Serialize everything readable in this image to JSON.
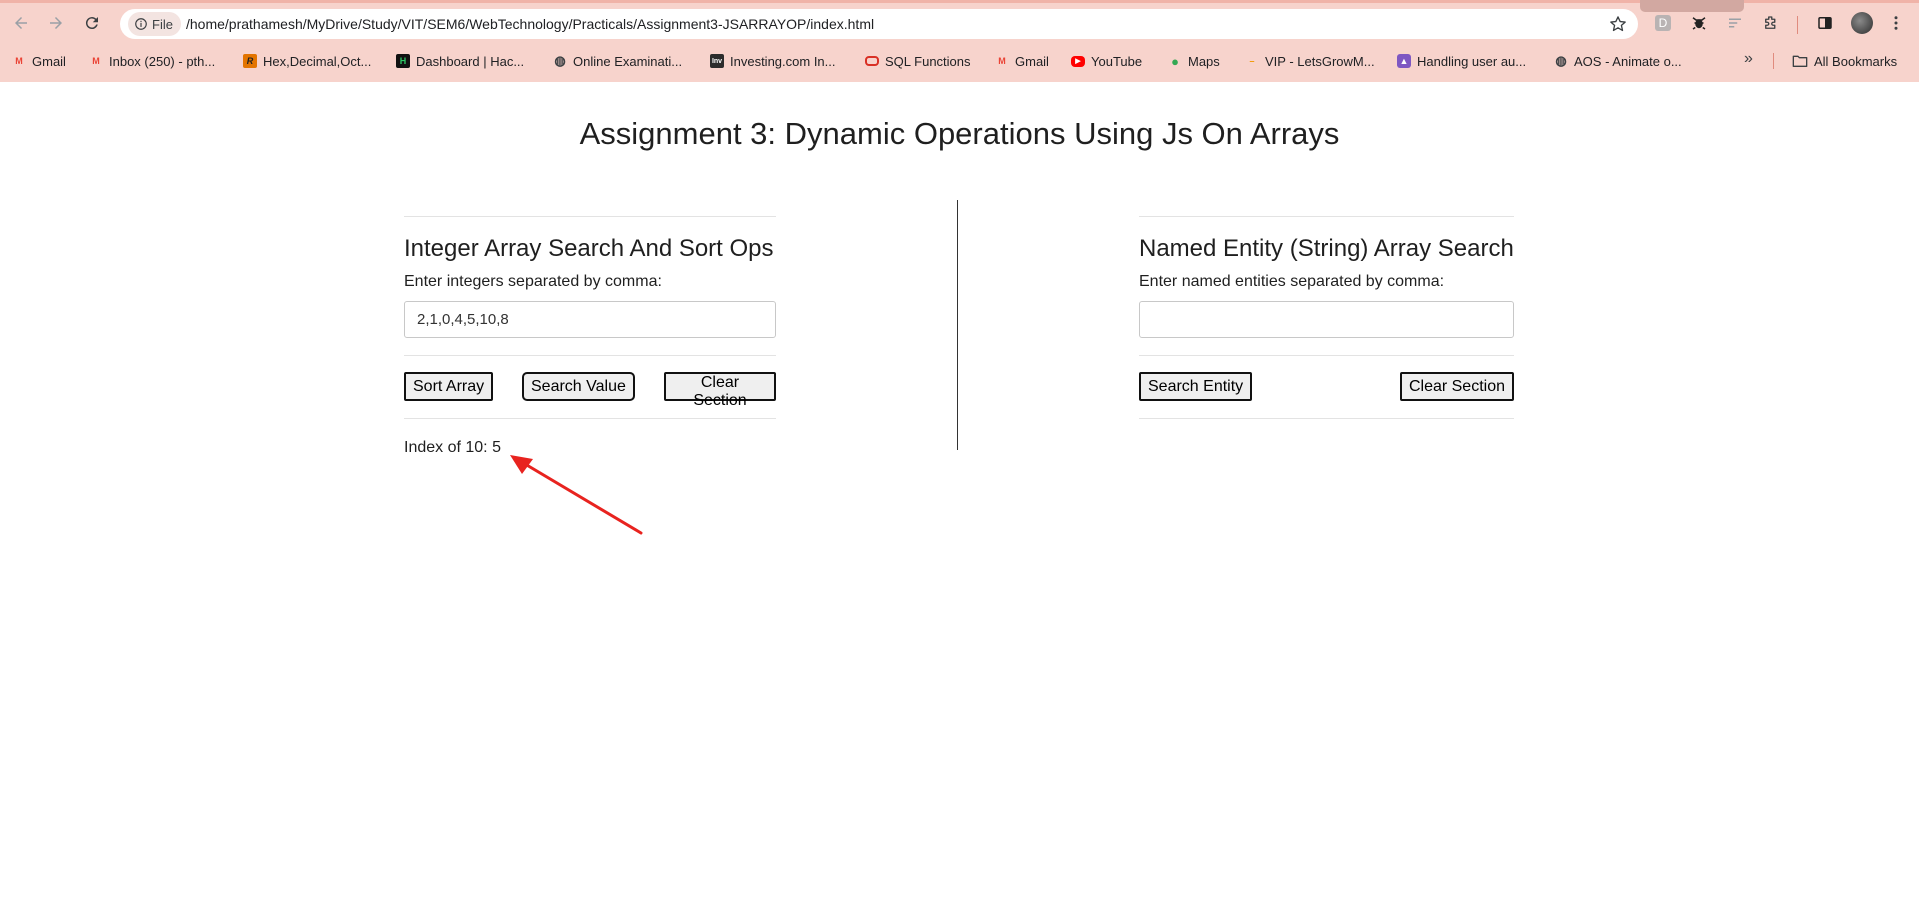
{
  "browser": {
    "url_scheme_label": "File",
    "url": "/home/prathamesh/MyDrive/Study/VIT/SEM6/WebTechnology/Practicals/Assignment3-JSARRAYOP/index.html",
    "extension_d_label": "D"
  },
  "bookmarks": {
    "items": [
      {
        "label": "Gmail",
        "icon": "gmail-icon",
        "color": "#ea4335"
      },
      {
        "label": "Inbox (250) - pth...",
        "icon": "gmail-icon",
        "color": "#ea4335"
      },
      {
        "label": "Hex,Decimal,Oct...",
        "icon": "r-icon",
        "color": "#e37400"
      },
      {
        "label": "Dashboard | Hac...",
        "icon": "hackerrank-icon",
        "color": "#111111"
      },
      {
        "label": "Online Examinati...",
        "icon": "globe-icon",
        "color": "#3c4043"
      },
      {
        "label": "Investing.com In...",
        "icon": "investing-icon",
        "color": "#2c2c2c"
      },
      {
        "label": "SQL Functions",
        "icon": "oracle-icon",
        "color": "#d93025"
      },
      {
        "label": "Gmail",
        "icon": "gmail-icon",
        "color": "#ea4335"
      },
      {
        "label": "YouTube",
        "icon": "youtube-icon",
        "color": "#ff0000"
      },
      {
        "label": "Maps",
        "icon": "maps-icon",
        "color": "#34a853"
      },
      {
        "label": "VIP - LetsGrowM...",
        "icon": "dash-icon",
        "color": "#f29900"
      },
      {
        "label": "Handling user au...",
        "icon": "rocket-icon",
        "color": "#7e57c2"
      },
      {
        "label": "AOS - Animate o...",
        "icon": "globe-icon",
        "color": "#3c4043"
      }
    ],
    "more_label": "»",
    "all_bookmarks_label": "All Bookmarks"
  },
  "page": {
    "title": "Assignment 3: Dynamic Operations Using Js On Arrays",
    "left": {
      "heading": "Integer Array Search And Sort Ops",
      "label": "Enter integers separated by comma:",
      "input_value": "2,1,0,4,5,10,8",
      "sort_label": "Sort Array",
      "search_label": "Search Value",
      "clear_label": "Clear Section",
      "result": "Index of 10: 5"
    },
    "right": {
      "heading": "Named Entity (String) Array Search",
      "label": "Enter named entities separated by comma:",
      "input_value": "",
      "search_label": "Search Entity",
      "clear_label": "Clear Section"
    }
  },
  "colors": {
    "chrome_bg": "#f7d3cc",
    "annotation_arrow": "#e8231f"
  }
}
